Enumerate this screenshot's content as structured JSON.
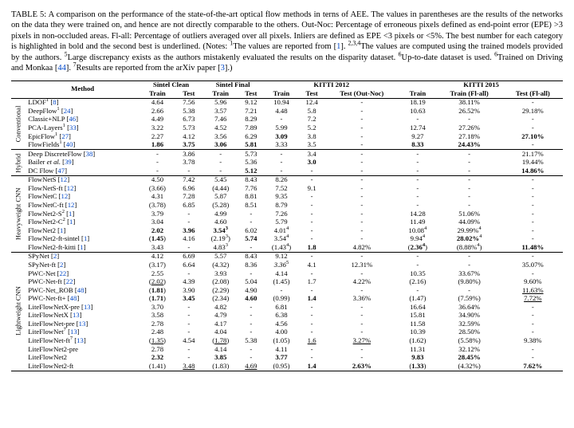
{
  "caption_html": "TABLE 5: A comparison on the performance of the state-of-the-art optical flow methods in terns of AEE. The values in parentheses are the results of the networks on the data they were trained on, and hence are not directly comparable to the others. Out-Noc: Percentage of erroneous pixels defined as end-point error (EPE) &gt;3 pixels in non-occluded areas. Fl-all: Percentage of outliers averaged over all pixels. Inliers are defined as EPE &lt;3 pixels or &lt;5%. The best number for each category is highlighted in bold and the second best is underlined. (Notes: <sup>1</sup>The values are reported from [<a>1</a>]. <sup>2,3,4</sup>The values are computed using the trained models provided by the authors. <sup>5</sup>Large discrepancy exists as the authors mistakenly evaluated the results on the disparity dataset. <sup>6</sup>Up-to-date dataset is used. <sup>6</sup>Trained on Driving and Monkaa [<a>44</a>]. <sup>7</sup>Results are reported from the arXiv paper [<a>3</a>].)",
  "headers": {
    "method": "Method",
    "sc": "Sintel Clean",
    "sf": "Sintel Final",
    "k12": "KITTI 2012",
    "k15": "KITTI 2015",
    "train": "Train",
    "test": "Test",
    "outnoc": "Test (Out-Noc)",
    "trainfl": "Train (Fl-all)",
    "testfl": "Test (Fl-all)"
  },
  "groups": [
    "Conventional",
    "Hybrid",
    "Heavyweight CNN",
    "Lightweight CNN"
  ],
  "rows": [
    {
      "g": 0,
      "m": "LDOF<sup>1</sup> [<a>8</a>]",
      "v": [
        "4.64",
        "7.56",
        "5.96",
        "9.12",
        "10.94",
        "12.4",
        "-",
        "18.19",
        "38.11%",
        "-"
      ]
    },
    {
      "g": 0,
      "m": "DeepFlow<sup>1</sup> [<a>24</a>]",
      "v": [
        "2.66",
        "5.38",
        "3.57",
        "7.21",
        "4.48",
        "5.8",
        "-",
        "10.63",
        "26.52%",
        "29.18%"
      ]
    },
    {
      "g": 0,
      "m": "Classic+NLP [<a>46</a>]",
      "v": [
        "4.49",
        "6.73",
        "7.46",
        "8.29",
        "-",
        "7.2",
        "-",
        "-",
        "-",
        "-"
      ]
    },
    {
      "g": 0,
      "m": "PCA-Layers<sup>1</sup> [<a>33</a>]",
      "v": [
        "3.22",
        "5.73",
        "4.52",
        "7.89",
        "5.99",
        "5.2",
        "-",
        "12.74",
        "27.26%",
        "-"
      ]
    },
    {
      "g": 0,
      "m": "EpicFlow<sup>1</sup> [<a>27</a>]",
      "v": [
        "2.27",
        "4.12",
        "3.56",
        "6.29",
        "<b>3.09</b>",
        "3.8",
        "-",
        "9.27",
        "27.18%",
        "<b>27.10%</b>"
      ]
    },
    {
      "g": 0,
      "m": "FlowFields<sup>1</sup> [<a>40</a>]",
      "v": [
        "<b>1.86</b>",
        "<b>3.75</b>",
        "<b>3.06</b>",
        "<b>5.81</b>",
        "3.33",
        "3.5",
        "-",
        "<b>8.33</b>",
        "<b>24.43%</b>",
        "-"
      ]
    },
    {
      "g": 1,
      "m": "Deep DiscreteFlow [<a>38</a>]",
      "v": [
        "-",
        "3.86",
        "-",
        "5.73",
        "-",
        "3.4",
        "-",
        "-",
        "-",
        "21.17%"
      ]
    },
    {
      "g": 1,
      "m": "Bailer <i>et al.</i> [<a>39</a>]",
      "v": [
        "-",
        "3.78",
        "-",
        "5.36",
        "-",
        "<b>3.0</b>",
        "-",
        "-",
        "-",
        "19.44%"
      ]
    },
    {
      "g": 1,
      "m": "DC Flow [<a>47</a>]",
      "v": [
        "-",
        "-",
        "-",
        "<b>5.12</b>",
        "-",
        "-",
        "-",
        "-",
        "-",
        "<b>14.86%</b>"
      ]
    },
    {
      "g": 2,
      "m": "FlowNetS [<a>12</a>]",
      "v": [
        "4.50",
        "7.42",
        "5.45",
        "8.43",
        "8.26",
        "-",
        "-",
        "-",
        "-",
        "-"
      ]
    },
    {
      "g": 2,
      "m": "FlowNetS-ft [<a>12</a>]",
      "v": [
        "(3.66)",
        "6.96",
        "(4.44)",
        "7.76",
        "7.52",
        "9.1",
        "-",
        "-",
        "-",
        "-"
      ]
    },
    {
      "g": 2,
      "m": "FlowNetC [<a>12</a>]",
      "v": [
        "4.31",
        "7.28",
        "5.87",
        "8.81",
        "9.35",
        "-",
        "-",
        "-",
        "-",
        "-"
      ]
    },
    {
      "g": 2,
      "m": "FlowNetC-ft [<a>12</a>]",
      "v": [
        "(3.78)",
        "6.85",
        "(5.28)",
        "8.51",
        "8.79",
        "-",
        "-",
        "-",
        "-",
        "-"
      ]
    },
    {
      "g": 2,
      "m": "FlowNet2-S<sup>2</sup> [<a>1</a>]",
      "v": [
        "3.79",
        "-",
        "4.99",
        "-",
        "7.26",
        "-",
        "-",
        "14.28",
        "51.06%",
        "-"
      ]
    },
    {
      "g": 2,
      "m": "FlowNet2-C<sup>2</sup> [<a>1</a>]",
      "v": [
        "3.04",
        "-",
        "4.60",
        "-",
        "5.79",
        "-",
        "-",
        "11.49",
        "44.09%",
        "-"
      ]
    },
    {
      "g": 2,
      "m": "FlowNet2 [<a>1</a>]",
      "v": [
        "<b>2.02</b>",
        "<b>3.96</b>",
        "<b>3.54<sup>3</sup></b>",
        "6.02",
        "4.01<sup>4</sup>",
        "-",
        "-",
        "10.08<sup>4</sup>",
        "29.99%<sup>4</sup>",
        "-"
      ]
    },
    {
      "g": 2,
      "m": "FlowNet2-ft-sintel [<a>1</a>]",
      "v": [
        "(<b>1.45</b>)",
        "4.16",
        "(2.19<sup>3</sup>)",
        "<b>5.74</b>",
        "3.54<sup>4</sup>",
        "-",
        "-",
        "9.94<sup>4</sup>",
        "<b>28.02%</b><sup>4</sup>",
        "-"
      ]
    },
    {
      "g": 2,
      "m": "FlowNet2-ft-kitti [<a>1</a>]",
      "v": [
        "3.43",
        "-",
        "4.83<sup>3</sup>",
        "-",
        "(1.43<sup>4</sup>)",
        "<b>1.8</b>",
        "4.82%",
        "(<b>2.36<sup>4</sup></b>)",
        "(8.88%<sup>4</sup>)",
        "<b>11.48%</b>"
      ]
    },
    {
      "g": 3,
      "m": "SPyNet [<a>2</a>]",
      "v": [
        "4.12",
        "6.69",
        "5.57",
        "8.43",
        "9.12",
        "-",
        "-",
        "-",
        "-",
        "-"
      ]
    },
    {
      "g": 3,
      "m": "SPyNet-ft [<a>2</a>]",
      "v": [
        "(3.17)",
        "6.64",
        "(4.32)",
        "8.36",
        "<i>3.36</i><sup>5</sup>",
        "4.1",
        "12.31%",
        "-",
        "-",
        "35.07%"
      ]
    },
    {
      "g": 3,
      "m": "PWC-Net [<a>22</a>]",
      "v": [
        "2.55",
        "-",
        "3.93",
        "-",
        "4.14",
        "-",
        "-",
        "10.35",
        "33.67%",
        "-"
      ]
    },
    {
      "g": 3,
      "m": "PWC-Net-ft [<a>22</a>]",
      "v": [
        "(<u>2.02</u>)",
        "4.39",
        "(2.08)",
        "5.04",
        "(1.45)",
        "1.7",
        "4.22%",
        "(2.16)",
        "(9.80%)",
        "9.60%"
      ]
    },
    {
      "g": 3,
      "m": "PWC-Net_ROB [<a>48</a>]",
      "v": [
        "(<b>1.81</b>)",
        "3.90",
        "(2.29)",
        "4.90",
        "-",
        "-",
        "-",
        "-",
        "-",
        "<u>11.63%</u>"
      ]
    },
    {
      "g": 3,
      "m": "PWC-Net-ft+ [<a>48</a>]",
      "v": [
        "(<b>1.71</b>)",
        "<b>3.45</b>",
        "(2.34)",
        "<b>4.60</b>",
        "(0.99)",
        "<b>1.4</b>",
        "3.36%",
        "(1.47)",
        "(7.59%)",
        "<u>7.72%</u>"
      ]
    },
    {
      "g": 3,
      "m": "LiteFlowNetX-pre [<a>13</a>]",
      "v": [
        "3.70",
        "-",
        "4.82",
        "-",
        "6.81",
        "-",
        "-",
        "16.64",
        "36.64%",
        "-"
      ]
    },
    {
      "g": 3,
      "m": "LiteFlowNetX [<a>13</a>]",
      "v": [
        "3.58",
        "-",
        "4.79",
        "-",
        "6.38",
        "-",
        "-",
        "15.81",
        "34.90%",
        "-"
      ]
    },
    {
      "g": 3,
      "m": "LiteFlowNet-pre [<a>13</a>]",
      "v": [
        "2.78",
        "-",
        "4.17",
        "-",
        "4.56",
        "-",
        "-",
        "11.58",
        "32.59%",
        "-"
      ]
    },
    {
      "g": 3,
      "m": "LiteFlowNet<sup>7</sup> [<a>13</a>]",
      "v": [
        "2.48",
        "-",
        "4.04",
        "-",
        "4.00",
        "-",
        "-",
        "10.39",
        "28.50%",
        "-"
      ]
    },
    {
      "g": 3,
      "m": "LiteFlowNet-ft<sup>7</sup> [<a>13</a>]",
      "v": [
        "(<u>1.35</u>)",
        "4.54",
        "(<u>1.78</u>)",
        "5.38",
        "(1.05)",
        "<u>1.6</u>",
        "<u>3.27%</u>",
        "(1.62)",
        "(5.58%)",
        "9.38%"
      ]
    },
    {
      "g": 3,
      "m": "LiteFlowNet2-pre",
      "v": [
        "2.78",
        "-",
        "4.14",
        "-",
        "4.11",
        "-",
        "-",
        "11.31",
        "32.12%",
        "-"
      ]
    },
    {
      "g": 3,
      "m": "LiteFlowNet2",
      "v": [
        "<b>2.32</b>",
        "-",
        "<b>3.85</b>",
        "-",
        "<b>3.77</b>",
        "-",
        "-",
        "<b>9.83</b>",
        "<b>28.45%</b>",
        "-"
      ]
    },
    {
      "g": 3,
      "m": "LiteFlowNet2-ft",
      "v": [
        "(1.41)",
        "<u>3.48</u>",
        "(1.83)",
        "<u>4.69</u>",
        "(0.95)",
        "<b>1.4</b>",
        "<b>2.63%</b>",
        "(<b>1.33</b>)",
        "(4.32%)",
        "<b>7.62%</b>"
      ]
    }
  ],
  "chart_data": {
    "type": "table",
    "title": "TABLE 5: Comparison of state-of-the-art optical flow methods in terms of AEE",
    "columns": [
      "Method",
      "Sintel Clean Train",
      "Sintel Clean Test",
      "Sintel Final Train",
      "Sintel Final Test",
      "KITTI 2012 Train",
      "KITTI 2012 Test",
      "KITTI 2012 Test (Out-Noc)",
      "KITTI 2015 Train",
      "KITTI 2015 Train (Fl-all)",
      "KITTI 2015 Test (Fl-all)"
    ],
    "notes": "Parenthesized values are fine-tuned (same-data) results; bold = best, underline = second best"
  }
}
